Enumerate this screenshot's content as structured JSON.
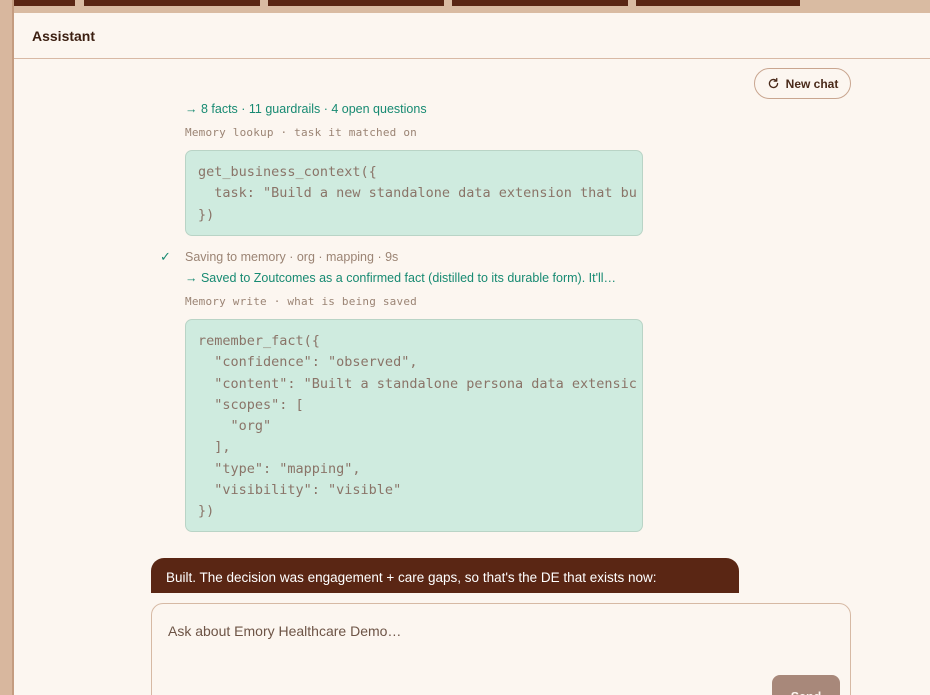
{
  "header": {
    "title": "Assistant"
  },
  "toolbar": {
    "new_chat_label": "New chat"
  },
  "tool_calls": [
    {
      "result": "→ 8 facts · 11 guardrails · 4 open questions",
      "label": "Memory lookup · task it matched on",
      "code": [
        "get_business_context({",
        "  task: \"Build a new standalone data extension that bu",
        "})"
      ]
    },
    {
      "status": "Saving to memory · org · mapping · 9s",
      "result": "→ Saved to Zoutcomes as a confirmed fact (distilled to its durable form). It'll…",
      "label": "Memory write · what is being saved",
      "code": [
        "remember_fact({",
        "  \"confidence\": \"observed\",",
        "  \"content\": \"Built a standalone persona data extensic",
        "  \"scopes\": [",
        "    \"org\"",
        "  ],",
        "  \"type\": \"mapping\",",
        "  \"visibility\": \"visible\"",
        "})"
      ]
    }
  ],
  "reply": {
    "text": "Built. The decision was engagement + care gaps, so that's the DE that exists now:"
  },
  "composer": {
    "placeholder": "Ask about Emory Healthcare Demo…",
    "send_label": "Send"
  },
  "colors": {
    "accent_brown": "#5a2614",
    "success_green": "#178a72",
    "code_bg": "#cfebdf"
  }
}
